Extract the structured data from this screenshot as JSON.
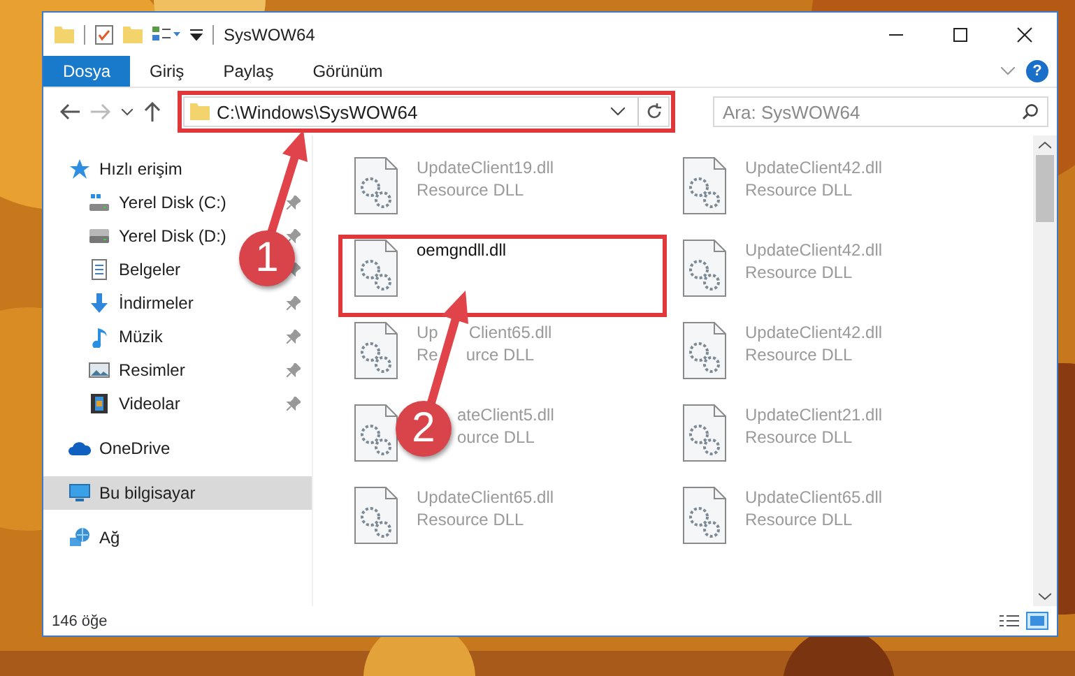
{
  "window": {
    "title": "SysWOW64"
  },
  "ribbon_tabs": [
    {
      "label": "Dosya",
      "selected": true
    },
    {
      "label": "Giriş",
      "selected": false
    },
    {
      "label": "Paylaş",
      "selected": false
    },
    {
      "label": "Görünüm",
      "selected": false
    }
  ],
  "help": "?",
  "address": {
    "path": "C:\\Windows\\SysWOW64",
    "highlighted": true
  },
  "search": {
    "placeholder": "Ara: SysWOW64"
  },
  "sidebar": {
    "items": [
      {
        "label": "Hızlı erişim",
        "kind": "star",
        "selected": false,
        "children": [
          {
            "label": "Yerel Disk (C:)",
            "kind": "drive-c",
            "pinned": true,
            "selected": false
          },
          {
            "label": "Yerel Disk (D:)",
            "kind": "drive",
            "pinned": true,
            "selected": false
          },
          {
            "label": "Belgeler",
            "kind": "documents",
            "pinned": true,
            "selected": false
          },
          {
            "label": "İndirmeler",
            "kind": "downloads",
            "pinned": true,
            "selected": false
          },
          {
            "label": "Müzik",
            "kind": "music",
            "pinned": true,
            "selected": false
          },
          {
            "label": "Resimler",
            "kind": "pictures",
            "pinned": true,
            "selected": false
          },
          {
            "label": "Videolar",
            "kind": "videos",
            "pinned": true,
            "selected": false
          }
        ]
      },
      {
        "label": "OneDrive",
        "kind": "cloud",
        "selected": false
      },
      {
        "label": "Bu bilgisayar",
        "kind": "computer",
        "selected": true
      },
      {
        "label": "Ağ",
        "kind": "network",
        "selected": false
      }
    ]
  },
  "files": [
    {
      "name": [
        "UpdateClient19.dll"
      ],
      "type": [
        "Resource DLL"
      ],
      "blurred": true,
      "highlighted": false
    },
    {
      "name": [
        "UpdateClient42.dll"
      ],
      "type": [
        "Resource DLL"
      ],
      "blurred": true,
      "highlighted": false
    },
    {
      "name": [
        "oemgndll.dll"
      ],
      "blurred": false,
      "highlighted": true
    },
    {
      "name": [
        "UpdateClient42.dll"
      ],
      "type": [
        "Resource DLL"
      ],
      "blurred": true,
      "highlighted": false
    },
    {
      "name": [
        "Up",
        "Client65.dll"
      ],
      "type": [
        "Re",
        "urce DLL"
      ],
      "blurred": true,
      "highlighted": false
    },
    {
      "name": [
        "UpdateClient42.dll"
      ],
      "type": [
        "Resource DLL"
      ],
      "blurred": true,
      "highlighted": false
    },
    {
      "name": [
        "ateClient5.dll"
      ],
      "type": [
        "ource DLL"
      ],
      "blurred": true,
      "highlighted": false,
      "covered": true
    },
    {
      "name": [
        "UpdateClient21.dll"
      ],
      "type": [
        "Resource DLL"
      ],
      "blurred": true,
      "highlighted": false
    },
    {
      "name": [
        "UpdateClient65.dll"
      ],
      "type": [
        "Resource DLL"
      ],
      "blurred": true,
      "highlighted": false
    },
    {
      "name": [
        "UpdateClient65.dll"
      ],
      "type": [
        "Resource DLL"
      ],
      "blurred": true,
      "highlighted": false
    }
  ],
  "status_bar": {
    "count": "146 öğe",
    "views": [
      {
        "kind": "details",
        "selected": false
      },
      {
        "kind": "large-icons",
        "selected": true
      }
    ]
  },
  "annotations": [
    {
      "number": "1"
    },
    {
      "number": "2"
    }
  ]
}
